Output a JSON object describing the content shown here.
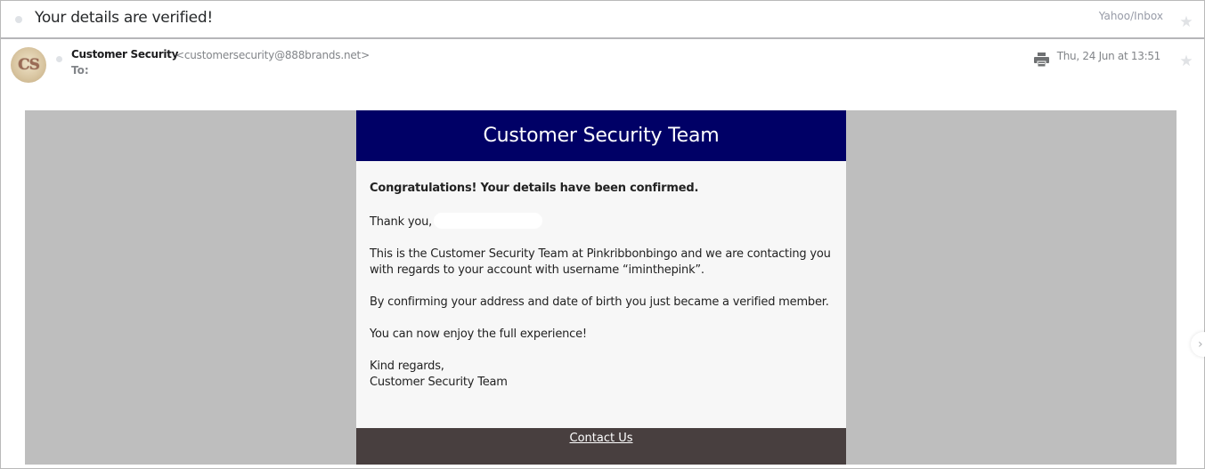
{
  "header": {
    "subject": "Your details are verified!",
    "folder_path": "Yahoo/Inbox",
    "star_icon": "star-icon"
  },
  "sender": {
    "avatar_initials": "CS",
    "name": "Customer Security",
    "email": "<customersecurity@888brands.net>",
    "to_label": "To:",
    "date": "Thu, 24 Jun at 13:51",
    "print_icon": "print-icon"
  },
  "message": {
    "banner_title": "Customer Security Team",
    "greeting": "Congratulations! Your details have been confirmed.",
    "thank_you": "Thank you,",
    "paragraph_1": "This is the Customer Security Team at Pinkribbonbingo and we are contacting you with regards to your account with username “iminthepink”.",
    "paragraph_2": "By confirming your address and date of birth you just became a verified member.",
    "paragraph_3": "You can now enjoy the full experience!",
    "sign_off": "Kind regards,",
    "signature": "Customer Security Team",
    "footer_link": "Contact Us"
  },
  "navigation": {
    "next_arrow": "›"
  },
  "colors": {
    "banner": "#000066",
    "footer": "#483f3f",
    "body_bg": "#bebebe",
    "card_bg": "#f7f7f7"
  }
}
